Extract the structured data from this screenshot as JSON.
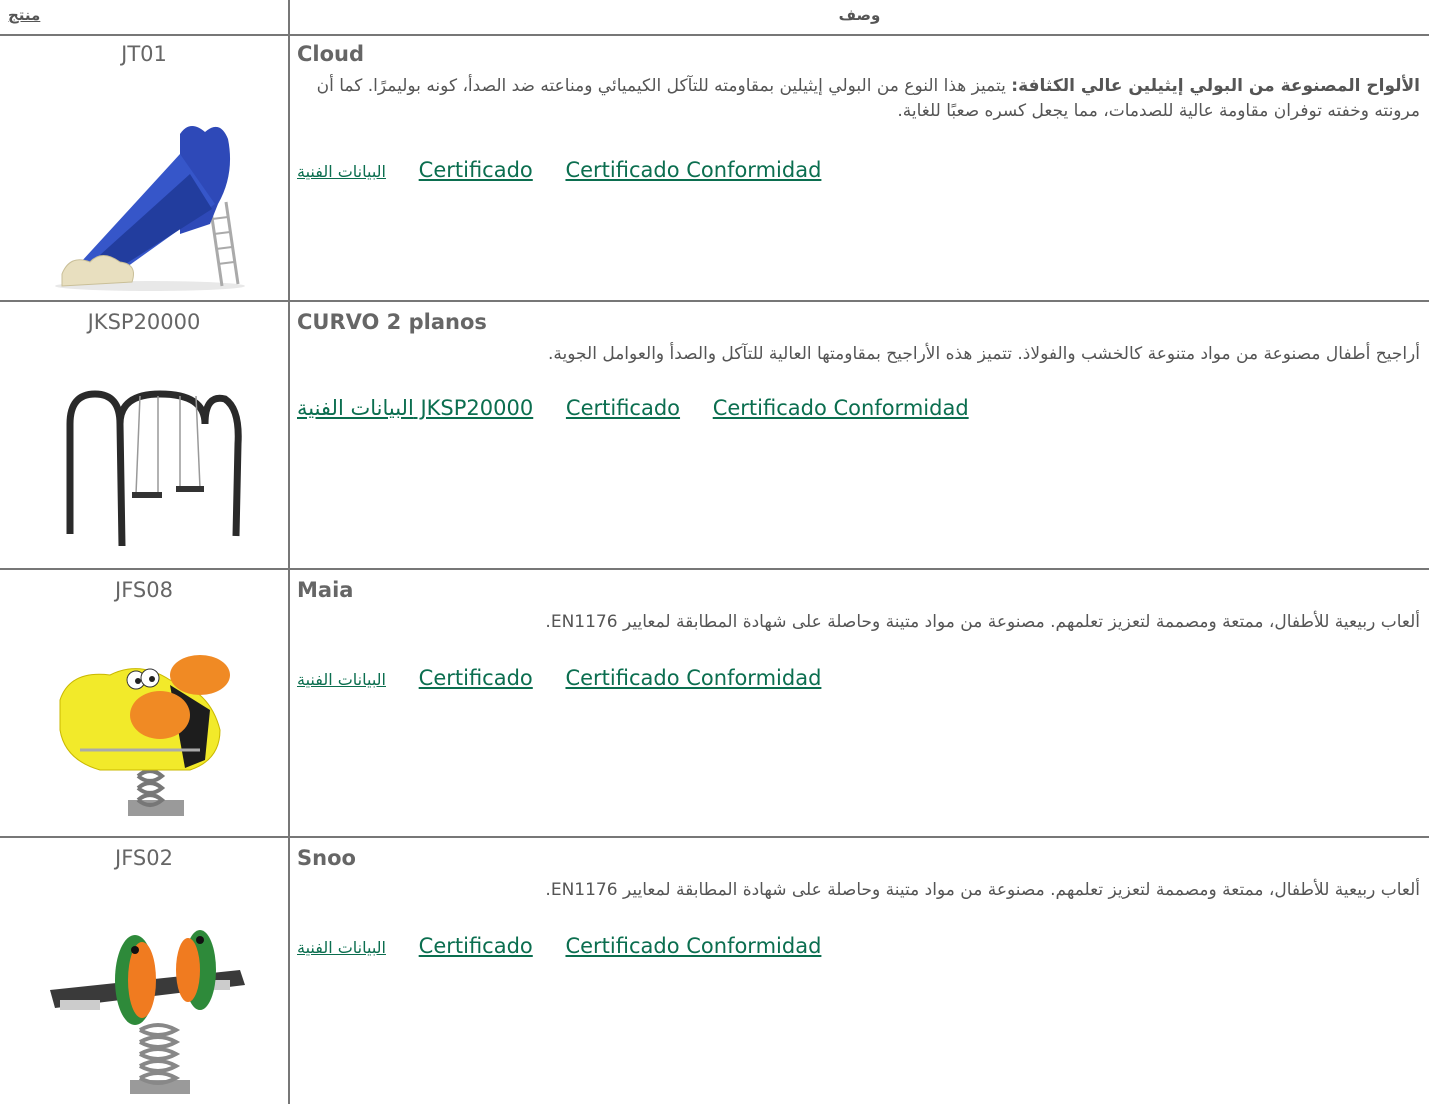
{
  "header": {
    "product": "منتج",
    "description": "وصف"
  },
  "rows": [
    {
      "code": "JT01",
      "name": "Cloud",
      "desc_bold": "الألواح المصنوعة من البولي إيثيلين عالي الكثافة:",
      "desc": " يتميز هذا النوع من البولي إيثيلين بمقاومته للتآكل الكيميائي ومناعته ضد الصدأ، كونه بوليمرًا. كما أن مرونته وخفته توفران مقاومة عالية للصدمات، مما يجعل كسره صعبًا للغاية.",
      "link_tech": "البيانات الفنية",
      "link_cert": "Certificado",
      "link_conf": "Certificado Conformidad"
    },
    {
      "code": "JKSP20000",
      "name": "CURVO 2 planos",
      "desc_bold": "",
      "desc": "أراجيح أطفال مصنوعة من مواد متنوعة كالخشب والفولاذ. تتميز هذه الأراجيح بمقاومتها العالية للتآكل والصدأ والعوامل الجوية.",
      "link_tech": "البيانات الفنية JKSP20000",
      "link_cert": "Certificado",
      "link_conf": "Certificado Conformidad"
    },
    {
      "code": "JFS08",
      "name": "Maia",
      "desc_bold": "",
      "desc": "ألعاب ربيعية للأطفال، ممتعة ومصممة لتعزيز تعلمهم. مصنوعة من مواد متينة وحاصلة على شهادة المطابقة لمعايير EN1176.",
      "link_tech": "البيانات الفنية",
      "link_cert": "Certificado",
      "link_conf": "Certificado Conformidad"
    },
    {
      "code": "JFS02",
      "name": "Snoo",
      "desc_bold": "",
      "desc": "ألعاب ربيعية للأطفال، ممتعة ومصممة لتعزيز تعلمهم. مصنوعة من مواد متينة وحاصلة على شهادة المطابقة لمعايير EN1176.",
      "link_tech": "البيانات الفنية",
      "link_cert": "Certificado",
      "link_conf": "Certificado Conformidad"
    }
  ]
}
